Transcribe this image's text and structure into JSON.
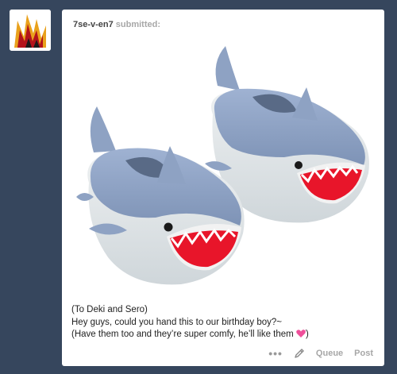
{
  "post": {
    "username": "7se-v-en7",
    "action": "submitted:",
    "caption": [
      "(To Deki and Sero)",
      "Hey guys, could you hand this to our birthday boy?~",
      "(Have them too and they’re super comfy, he’ll like them"
    ],
    "caption_end": ")",
    "caption_emoji": "pink-heart-icon"
  },
  "footer": {
    "more": "•••",
    "queue": "Queue",
    "post": "Post"
  },
  "colors": {
    "background": "#36465d",
    "card": "#ffffff",
    "muted": "#a7a7a7",
    "shark_body": "#8fa3c4",
    "shark_mouth": "#e8152a"
  }
}
